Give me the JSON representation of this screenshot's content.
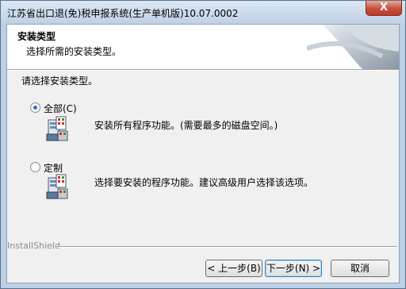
{
  "window": {
    "title": "江苏省出口退(免)税申报系统(生产单机版)10.07.0002",
    "close_glyph": "X"
  },
  "header": {
    "title": "安装类型",
    "subtitle": "选择所需的安装类型。"
  },
  "prompt": "请选择安装类型。",
  "options": [
    {
      "label": "全部(C)",
      "description": "安装所有程序功能。(需要最多的磁盘空间。)",
      "selected": true,
      "icon": "install-package-icon"
    },
    {
      "label": "定制",
      "description": "选择要安装的程序功能。建议高级用户选择该选项。",
      "selected": false,
      "icon": "install-package-icon"
    }
  ],
  "footer": {
    "brand": "InstallShield",
    "back_label": "< 上一步(B)",
    "next_label": "下一步(N) >",
    "cancel_label": "取消"
  },
  "colors": {
    "title_bar": "#bfd1e5",
    "close_button": "#c54f3c",
    "client_bg": "#f0f0f0",
    "header_bg": "#ffffff",
    "default_button_border": "#3c7fb1"
  }
}
